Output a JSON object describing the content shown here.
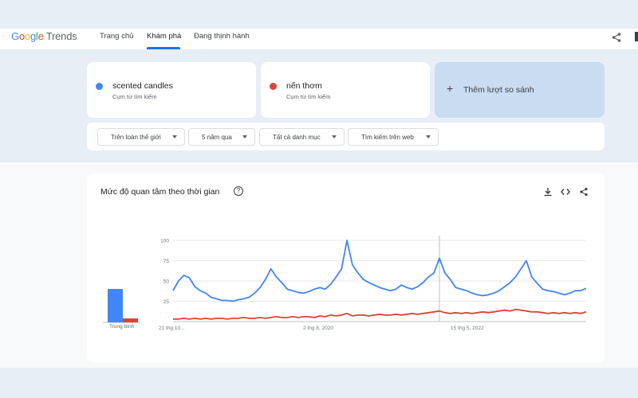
{
  "header": {
    "logo_google": "Google",
    "logo_trends": "Trends",
    "nav": [
      {
        "label": "Trang chủ"
      },
      {
        "label": "Khám phá"
      },
      {
        "label": "Đang thịnh hành"
      }
    ]
  },
  "terms": [
    {
      "name": "scented candles",
      "type": "Cụm từ tìm kiếm",
      "color": "#4285f4"
    },
    {
      "name": "nến thơm",
      "type": "Cụm từ tìm kiếm",
      "color": "#db4437"
    }
  ],
  "add_compare": {
    "icon": "+",
    "label": "Thêm lượt so sánh"
  },
  "filters": [
    {
      "label": "Trên toàn thế giới"
    },
    {
      "label": "5 năm qua"
    },
    {
      "label": "Tất cả danh mục"
    },
    {
      "label": "Tìm kiếm trên web"
    }
  ],
  "chart_panel": {
    "title": "Mức độ quan tâm theo thời gian",
    "help": "?",
    "average_label": "Trung bình"
  },
  "chart_data": {
    "type": "line",
    "ylim": [
      0,
      100
    ],
    "yticks": [
      "100",
      "75",
      "50",
      "25"
    ],
    "xticks": [
      "21 thg 10...",
      "2 thg 8, 2020",
      "15 thg 5, 2022"
    ],
    "averages": [
      42,
      5
    ],
    "series": [
      {
        "name": "scented candles",
        "color": "#4285f4",
        "values": [
          38,
          50,
          57,
          54,
          43,
          38,
          35,
          30,
          28,
          26,
          26,
          25,
          27,
          28,
          30,
          35,
          42,
          52,
          65,
          55,
          48,
          40,
          38,
          36,
          35,
          37,
          40,
          42,
          40,
          46,
          55,
          65,
          100,
          70,
          60,
          52,
          48,
          45,
          42,
          40,
          38,
          40,
          45,
          42,
          40,
          43,
          48,
          55,
          60,
          78,
          60,
          52,
          42,
          40,
          38,
          35,
          33,
          32,
          33,
          35,
          38,
          43,
          48,
          55,
          65,
          75,
          55,
          47,
          40,
          38,
          37,
          35,
          33,
          35,
          38,
          38,
          41
        ]
      },
      {
        "name": "nến thơm",
        "color": "#db4437",
        "values": [
          3,
          3,
          4,
          3,
          4,
          3,
          4,
          3,
          4,
          4,
          3,
          4,
          4,
          5,
          4,
          4,
          5,
          4,
          5,
          6,
          5,
          5,
          6,
          5,
          6,
          6,
          5,
          7,
          6,
          8,
          7,
          8,
          10,
          7,
          8,
          8,
          7,
          8,
          9,
          8,
          8,
          9,
          8,
          9,
          10,
          9,
          10,
          11,
          12,
          13,
          11,
          10,
          11,
          10,
          11,
          10,
          11,
          12,
          11,
          12,
          13,
          14,
          13,
          15,
          14,
          13,
          12,
          12,
          11,
          10,
          11,
          10,
          11,
          10,
          11,
          10,
          12
        ]
      }
    ]
  }
}
